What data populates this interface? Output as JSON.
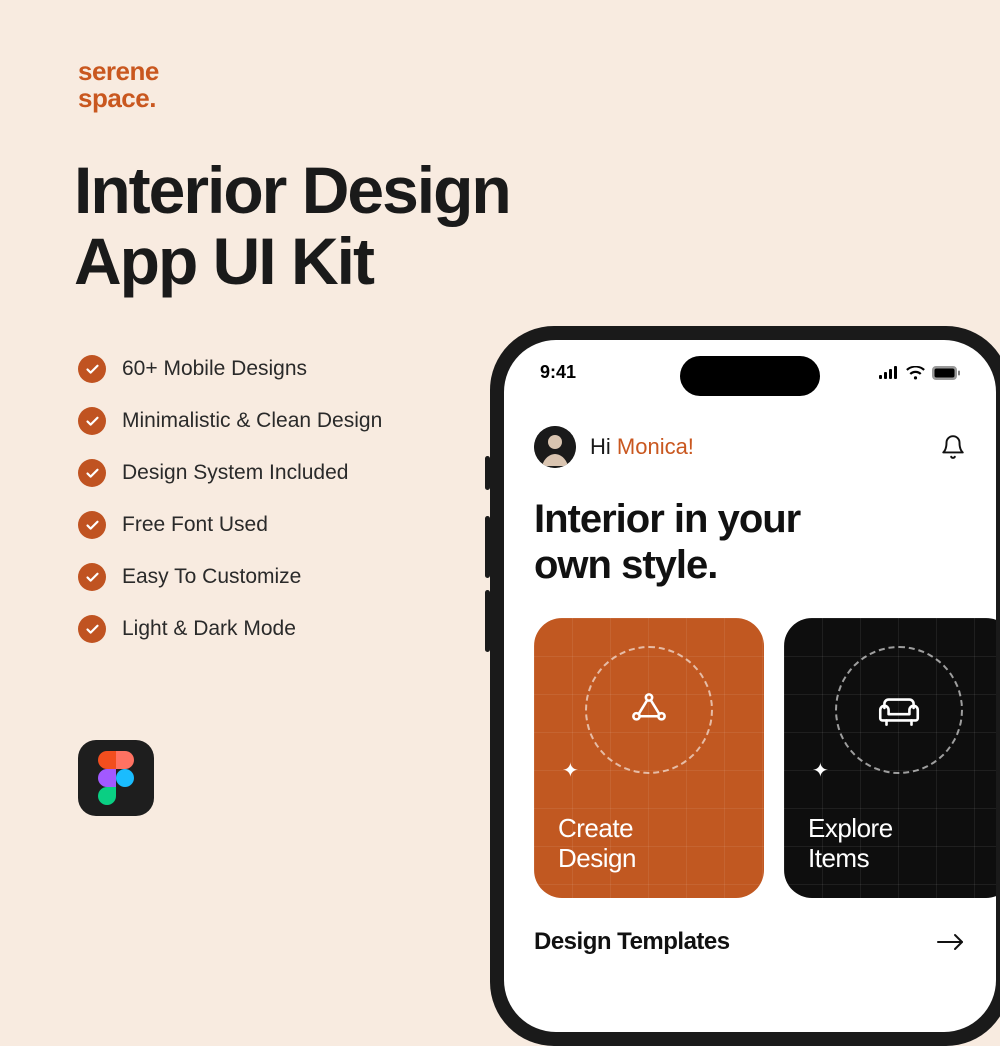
{
  "brand": {
    "line1": "serene",
    "line2": "space."
  },
  "headline": {
    "line1": "Interior Design",
    "line2": "App UI Kit"
  },
  "features": [
    "60+ Mobile Designs",
    "Minimalistic & Clean Design",
    "Design System Included",
    "Free Font Used",
    "Easy To Customize",
    "Light & Dark Mode"
  ],
  "phone": {
    "time": "9:41",
    "greeting_prefix": "Hi ",
    "greeting_name": "Monica!",
    "headline_line1": "Interior in your",
    "headline_line2": "own style.",
    "cards": {
      "create": {
        "line1": "Create",
        "line2": "Design"
      },
      "explore": {
        "line1": "Explore",
        "line2": "Items"
      }
    },
    "section": "Design Templates"
  }
}
